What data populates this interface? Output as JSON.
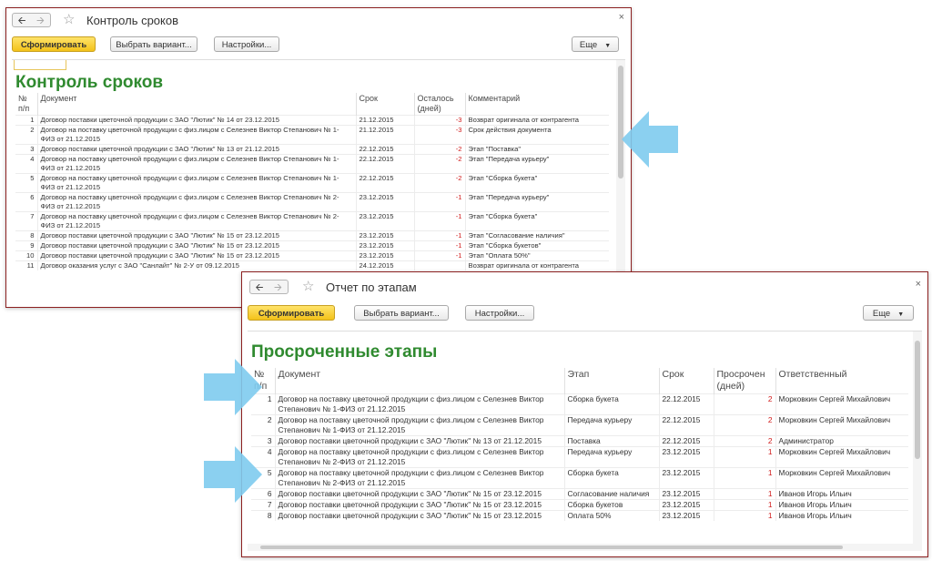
{
  "colors": {
    "accent_title": "#2f8a2f",
    "window_border": "#8c2020",
    "primary_button": "#f3c21a",
    "negative_value": "#d01a1a",
    "arrow": "#7ecbee"
  },
  "window1": {
    "back_icon": "arrow-left",
    "forward_icon": "arrow-right",
    "star_icon": "star",
    "title": "Контроль сроков",
    "close_icon": "×",
    "toolbar": {
      "generate": "Сформировать",
      "choose_variant": "Выбрать вариант...",
      "settings": "Настройки...",
      "more": "Еще"
    },
    "report_title": "Контроль сроков",
    "columns": [
      "№ п/п",
      "Документ",
      "Срок",
      "Осталось (дней)",
      "Комментарий"
    ],
    "rows": [
      {
        "n": "1",
        "doc": "Договор поставки цветочной продукции с ЗАО \"Лютик\" № 14 от 23.12.2015",
        "term": "21.12.2015",
        "left": "-3",
        "comment": "Возврат оригинала от контрагента"
      },
      {
        "n": "2",
        "doc": "Договор на поставку цветочной продукции с физ.лицом с Селезнев Виктор Степанович № 1-ФИЗ от 21.12.2015",
        "term": "21.12.2015",
        "left": "-3",
        "comment": "Срок действия документа"
      },
      {
        "n": "3",
        "doc": "Договор поставки цветочной продукции с ЗАО \"Лютик\" № 13 от 21.12.2015",
        "term": "22.12.2015",
        "left": "-2",
        "comment": "Этап \"Поставка\""
      },
      {
        "n": "4",
        "doc": "Договор на поставку цветочной продукции с физ.лицом с Селезнев Виктор Степанович № 1-ФИЗ от 21.12.2015",
        "term": "22.12.2015",
        "left": "-2",
        "comment": "Этап \"Передача курьеру\""
      },
      {
        "n": "5",
        "doc": "Договор на поставку цветочной продукции с физ.лицом с Селезнев Виктор Степанович № 1-ФИЗ от 21.12.2015",
        "term": "22.12.2015",
        "left": "-2",
        "comment": "Этап \"Сборка букета\""
      },
      {
        "n": "6",
        "doc": "Договор на поставку цветочной продукции с физ.лицом с Селезнев Виктор Степанович № 2-ФИЗ от 21.12.2015",
        "term": "23.12.2015",
        "left": "-1",
        "comment": "Этап \"Передача курьеру\""
      },
      {
        "n": "7",
        "doc": "Договор на поставку цветочной продукции с физ.лицом с Селезнев Виктор Степанович № 2-ФИЗ от 21.12.2015",
        "term": "23.12.2015",
        "left": "-1",
        "comment": "Этап \"Сборка букета\""
      },
      {
        "n": "8",
        "doc": "Договор поставки цветочной продукции с ЗАО \"Лютик\" № 15 от 23.12.2015",
        "term": "23.12.2015",
        "left": "-1",
        "comment": "Этап \"Согласование наличия\""
      },
      {
        "n": "9",
        "doc": "Договор поставки цветочной продукции с ЗАО \"Лютик\" № 15 от 23.12.2015",
        "term": "23.12.2015",
        "left": "-1",
        "comment": "Этап \"Сборка букетов\""
      },
      {
        "n": "10",
        "doc": "Договор поставки цветочной продукции с ЗАО \"Лютик\" № 15 от 23.12.2015",
        "term": "23.12.2015",
        "left": "-1",
        "comment": "Этап \"Оплата 50%\""
      },
      {
        "n": "11",
        "doc": "Договор оказания услуг с ЗАО \"Санлайт\" № 2-У от 09.12.2015",
        "term": "24.12.2015",
        "left": "",
        "comment": "Возврат оригинала от контрагента"
      }
    ]
  },
  "window2": {
    "back_icon": "arrow-left",
    "forward_icon": "arrow-right",
    "star_icon": "star",
    "title": "Отчет по этапам",
    "close_icon": "×",
    "toolbar": {
      "generate": "Сформировать",
      "choose_variant": "Выбрать вариант...",
      "settings": "Настройки...",
      "more": "Еще"
    },
    "report_title": "Просроченные этапы",
    "columns": [
      "№ п/п",
      "Документ",
      "Этап",
      "Срок",
      "Просрочен (дней)",
      "Ответственный"
    ],
    "rows": [
      {
        "n": "1",
        "doc": "Договор на поставку цветочной продукции с физ.лицом с Селезнев Виктор Степанович № 1-ФИЗ от 21.12.2015",
        "stage": "Сборка букета",
        "term": "22.12.2015",
        "overdue": "2",
        "resp": "Морковкин Сергей Михайлович"
      },
      {
        "n": "2",
        "doc": "Договор на поставку цветочной продукции с физ.лицом с Селезнев Виктор Степанович № 1-ФИЗ от 21.12.2015",
        "stage": "Передача курьеру",
        "term": "22.12.2015",
        "overdue": "2",
        "resp": "Морковкин Сергей Михайлович"
      },
      {
        "n": "3",
        "doc": "Договор поставки цветочной продукции с ЗАО \"Лютик\" № 13 от 21.12.2015",
        "stage": "Поставка",
        "term": "22.12.2015",
        "overdue": "2",
        "resp": "Администратор"
      },
      {
        "n": "4",
        "doc": "Договор на поставку цветочной продукции с физ.лицом с Селезнев Виктор Степанович № 2-ФИЗ от 21.12.2015",
        "stage": "Передача курьеру",
        "term": "23.12.2015",
        "overdue": "1",
        "resp": "Морковкин Сергей Михайлович"
      },
      {
        "n": "5",
        "doc": "Договор на поставку цветочной продукции с физ.лицом с Селезнев Виктор Степанович № 2-ФИЗ от 21.12.2015",
        "stage": "Сборка букета",
        "term": "23.12.2015",
        "overdue": "1",
        "resp": "Морковкин Сергей Михайлович"
      },
      {
        "n": "6",
        "doc": "Договор поставки цветочной продукции с ЗАО \"Лютик\" № 15 от 23.12.2015",
        "stage": "Согласование наличия",
        "term": "23.12.2015",
        "overdue": "1",
        "resp": "Иванов Игорь Ильич"
      },
      {
        "n": "7",
        "doc": "Договор поставки цветочной продукции с ЗАО \"Лютик\" № 15 от 23.12.2015",
        "stage": "Сборка букетов",
        "term": "23.12.2015",
        "overdue": "1",
        "resp": "Иванов Игорь Ильич"
      },
      {
        "n": "8",
        "doc": "Договор поставки цветочной продукции с ЗАО \"Лютик\" № 15 от 23.12.2015",
        "stage": "Оплата 50%",
        "term": "23.12.2015",
        "overdue": "1",
        "resp": "Иванов Игорь Ильич"
      }
    ]
  }
}
